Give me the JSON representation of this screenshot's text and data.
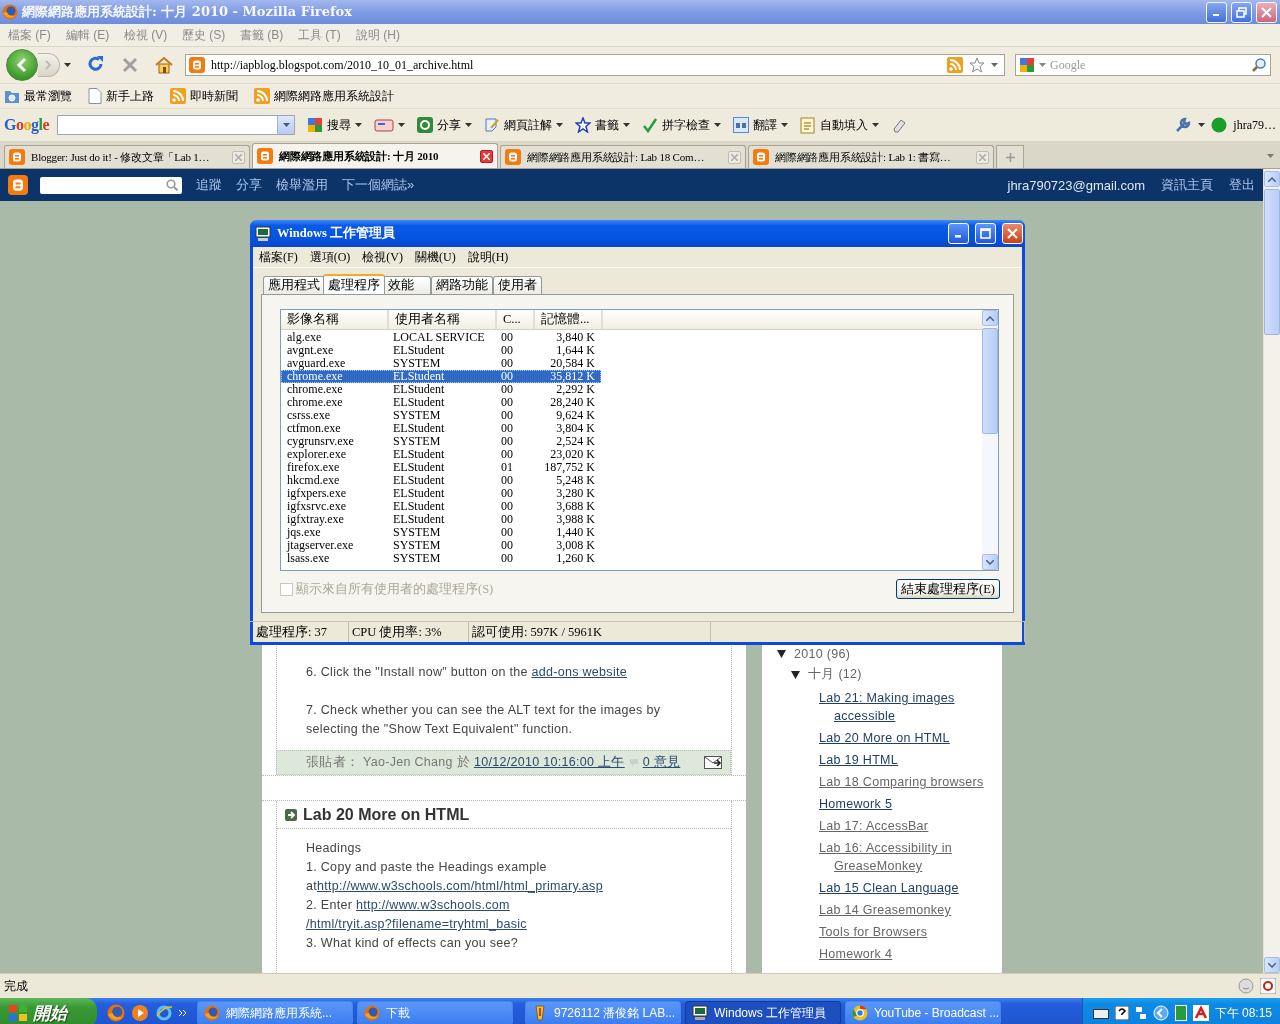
{
  "browser": {
    "title": "網際網路應用系統設計: 十月 2010 - Mozilla Firefox",
    "menu": [
      "檔案 (F)",
      "編輯 (E)",
      "檢視 (V)",
      "歷史 (S)",
      "書籤 (B)",
      "工具 (T)",
      "說明 (H)"
    ],
    "url": "http://iapblog.blogspot.com/2010_10_01_archive.html",
    "search_placeholder": "Google",
    "bookmarks": [
      {
        "label": "最常瀏覽",
        "kind": "folder"
      },
      {
        "label": "新手上路",
        "kind": "page"
      },
      {
        "label": "即時新聞",
        "kind": "feed"
      },
      {
        "label": "網際網路應用系統設計",
        "kind": "feed"
      }
    ],
    "google_toolbar": {
      "logo": "Google",
      "items": [
        {
          "label": "搜尋",
          "kind": "search"
        },
        {
          "kind": "card"
        },
        {
          "label": "分享",
          "kind": "share"
        },
        {
          "label": "網頁註解",
          "kind": "note"
        },
        {
          "label": "書籤",
          "kind": "star"
        },
        {
          "label": "拼字檢查",
          "kind": "spell"
        },
        {
          "label": "翻譯",
          "kind": "translate"
        },
        {
          "label": "自動填入",
          "kind": "autofill"
        },
        {
          "kind": "eraser"
        }
      ],
      "user": "jhra79…"
    },
    "tabs": [
      {
        "label": "Blogger: Just do it! - 修改文章「Lab 1…",
        "selected": false
      },
      {
        "label": "網際網路應用系統設計: 十月 2010",
        "selected": true
      },
      {
        "label": "網際網路應用系統設計: Lab 18 Com…",
        "selected": false
      },
      {
        "label": "網際網路應用系統設計: Lab 1: 書寫…",
        "selected": false
      }
    ]
  },
  "blogger_bar": {
    "links": [
      "追蹤",
      "分享",
      "檢舉濫用",
      "下一個網誌»"
    ],
    "email": "jhra790723@gmail.com",
    "right_links": [
      "資訊主頁",
      "登出"
    ]
  },
  "previous_post": {
    "paragraphs": [
      [
        {
          "text": "6. Click the \"Install now\" button on the "
        },
        {
          "text": "add-ons website",
          "link": true
        }
      ],
      [
        {
          "text": "7. Check whether you can see the ALT text for the images by selecting the \"Show Text Equivalent\" function."
        }
      ]
    ],
    "footer": {
      "author": "張貼者： Yao-Jen Chang 於",
      "timestamp": "10/12/2010 10:16:00 上午",
      "comments": "0 意見"
    }
  },
  "post": {
    "title": "Lab 20 More on HTML",
    "lines": [
      [
        {
          "text": "Headings"
        }
      ],
      [
        {
          "text": "1. Copy and paste the Headings example"
        }
      ],
      [
        {
          "text": "at"
        },
        {
          "text": "http://www.w3schools.com/html/html_primary.asp",
          "link": true
        }
      ],
      [
        {
          "text": "2. Enter "
        },
        {
          "text": "http://www.w3schools.com",
          "link": true
        }
      ],
      [
        {
          "text": "/html/tryit.asp?filename=tryhtml_basic",
          "link": true
        }
      ],
      [
        {
          "text": "3. What kind of effects can you see?"
        }
      ]
    ]
  },
  "archive": [
    {
      "label": "2010",
      "count": "(96)",
      "expanded": true,
      "children": [
        {
          "label": "十月",
          "count": "(12)",
          "expanded": true,
          "children": [
            {
              "label": "Lab 21: Making images accessible",
              "visited": false
            },
            {
              "label": "Lab 20 More on HTML",
              "visited": false
            },
            {
              "label": "Lab 19 HTML",
              "visited": false
            },
            {
              "label": "Lab 18 Comparing browsers",
              "visited": true
            },
            {
              "label": "Homework 5",
              "visited": false
            },
            {
              "label": "Lab 17: AccessBar",
              "visited": true
            },
            {
              "label": "Lab 16: Accessibility in GreaseMonkey",
              "visited": true
            },
            {
              "label": "Lab 15 Clean Language",
              "visited": false
            },
            {
              "label": "Lab 14 Greasemonkey",
              "visited": true
            },
            {
              "label": "Tools for Browsers",
              "visited": true
            },
            {
              "label": "Homework 4",
              "visited": true
            }
          ]
        }
      ]
    }
  ],
  "task_manager": {
    "title": "Windows 工作管理員",
    "menu": [
      "檔案(F)",
      "選項(O)",
      "檢視(V)",
      "關機(U)",
      "說明(H)"
    ],
    "tabs": [
      {
        "label": "應用程式",
        "selected": false
      },
      {
        "label": "處理程序",
        "selected": true
      },
      {
        "label": "效能",
        "selected": false
      },
      {
        "label": "網路功能",
        "selected": false
      },
      {
        "label": "使用者",
        "selected": false
      }
    ],
    "columns": [
      "影像名稱",
      "使用者名稱",
      "C...",
      "記憶體..."
    ],
    "rows": [
      {
        "name": "alg.exe",
        "user": "LOCAL SERVICE",
        "cpu": "00",
        "memory": "3,840 K",
        "selected": false
      },
      {
        "name": "avgnt.exe",
        "user": "ELStudent",
        "cpu": "00",
        "memory": "1,644 K",
        "selected": false
      },
      {
        "name": "avguard.exe",
        "user": "SYSTEM",
        "cpu": "00",
        "memory": "20,584 K",
        "selected": false
      },
      {
        "name": "chrome.exe",
        "user": "ELStudent",
        "cpu": "00",
        "memory": "35,812 K",
        "selected": true
      },
      {
        "name": "chrome.exe",
        "user": "ELStudent",
        "cpu": "00",
        "memory": "2,292 K",
        "selected": false
      },
      {
        "name": "chrome.exe",
        "user": "ELStudent",
        "cpu": "00",
        "memory": "28,240 K",
        "selected": false
      },
      {
        "name": "csrss.exe",
        "user": "SYSTEM",
        "cpu": "00",
        "memory": "9,624 K",
        "selected": false
      },
      {
        "name": "ctfmon.exe",
        "user": "ELStudent",
        "cpu": "00",
        "memory": "3,804 K",
        "selected": false
      },
      {
        "name": "cygrunsrv.exe",
        "user": "SYSTEM",
        "cpu": "00",
        "memory": "2,524 K",
        "selected": false
      },
      {
        "name": "explorer.exe",
        "user": "ELStudent",
        "cpu": "00",
        "memory": "23,020 K",
        "selected": false
      },
      {
        "name": "firefox.exe",
        "user": "ELStudent",
        "cpu": "01",
        "memory": "187,752 K",
        "selected": false
      },
      {
        "name": "hkcmd.exe",
        "user": "ELStudent",
        "cpu": "00",
        "memory": "5,248 K",
        "selected": false
      },
      {
        "name": "igfxpers.exe",
        "user": "ELStudent",
        "cpu": "00",
        "memory": "3,280 K",
        "selected": false
      },
      {
        "name": "igfxsrvc.exe",
        "user": "ELStudent",
        "cpu": "00",
        "memory": "3,688 K",
        "selected": false
      },
      {
        "name": "igfxtray.exe",
        "user": "ELStudent",
        "cpu": "00",
        "memory": "3,988 K",
        "selected": false
      },
      {
        "name": "jqs.exe",
        "user": "SYSTEM",
        "cpu": "00",
        "memory": "1,440 K",
        "selected": false
      },
      {
        "name": "jtagserver.exe",
        "user": "SYSTEM",
        "cpu": "00",
        "memory": "3,008 K",
        "selected": false
      },
      {
        "name": "lsass.exe",
        "user": "SYSTEM",
        "cpu": "00",
        "memory": "1,260 K",
        "selected": false
      }
    ],
    "show_all_users": {
      "label": "顯示來自所有使用者的處理程序(S)",
      "checked": false,
      "disabled": true
    },
    "end_button": "結束處理程序(E)",
    "status": [
      "處理程序: 37",
      "CPU 使用率: 3%",
      "認可使用: 597K / 5961K"
    ]
  },
  "status_bar": "完成",
  "taskbar": {
    "start": "開始",
    "tasks": [
      {
        "label": "網際網路應用系統...",
        "kind": "firefox",
        "selected": false
      },
      {
        "label": "下載",
        "kind": "firefox",
        "selected": false
      },
      {
        "label": "9726112 潘俊銘 LAB...",
        "kind": "paint",
        "selected": false
      },
      {
        "label": "Windows 工作管理員",
        "kind": "monitor",
        "selected": true
      },
      {
        "label": "YouTube - Broadcast ...",
        "kind": "chrome",
        "selected": false
      }
    ],
    "clock": "下午 08:15"
  }
}
